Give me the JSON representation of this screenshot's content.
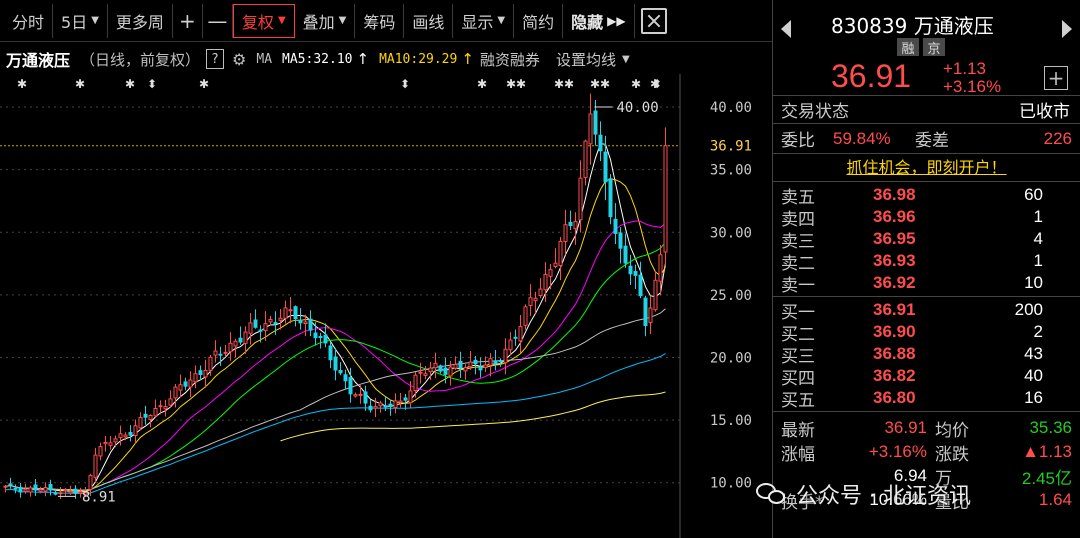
{
  "toolbar": {
    "items": [
      "分时",
      "5日",
      "更多周",
      "+",
      "—",
      "复权",
      "叠加",
      "筹码",
      "画线",
      "显示",
      "简约",
      "隐藏"
    ]
  },
  "chart_header": {
    "name": "万通液压",
    "period": "（日线，前复权）",
    "help": "?",
    "ma_label": "MA",
    "ma5": "MA5:32.10",
    "ma10": "MA10:29.29",
    "rz": "融资融券",
    "setting": "设置均线"
  },
  "chart_data": {
    "type": "candlestick",
    "y_ticks": [
      "40.00",
      "35.00",
      "30.00",
      "25.00",
      "20.00",
      "15.00",
      "10.00"
    ],
    "ylim": [
      7.5,
      42
    ],
    "high_label": "40.00",
    "low_label": "8.91",
    "current_price_label": "36.91",
    "current_price": 36.91
  },
  "quote": {
    "code_name": "830839 万通液压",
    "tags": [
      "融",
      "京"
    ],
    "price": "36.91",
    "change": "+1.13",
    "change_pct": "+3.16%",
    "trade_state_label": "交易状态",
    "trade_state": "已收市",
    "ratio_label": "委比",
    "ratio": "59.84%",
    "diff_label": "委差",
    "diff": "226",
    "ad": "抓住机会，即刻开户！",
    "asks": [
      {
        "label": "卖五",
        "price": "36.98",
        "vol": "60"
      },
      {
        "label": "卖四",
        "price": "36.96",
        "vol": "1"
      },
      {
        "label": "卖三",
        "price": "36.95",
        "vol": "4"
      },
      {
        "label": "卖二",
        "price": "36.93",
        "vol": "1"
      },
      {
        "label": "卖一",
        "price": "36.92",
        "vol": "10"
      }
    ],
    "bids": [
      {
        "label": "买一",
        "price": "36.91",
        "vol": "200"
      },
      {
        "label": "买二",
        "price": "36.90",
        "vol": "2"
      },
      {
        "label": "买三",
        "price": "36.88",
        "vol": "43"
      },
      {
        "label": "买四",
        "price": "36.82",
        "vol": "40"
      },
      {
        "label": "买五",
        "price": "36.80",
        "vol": "16"
      }
    ],
    "stats": [
      {
        "k": "最新",
        "v": "36.91",
        "k2": "均价",
        "v2": "35.36"
      },
      {
        "k": "涨幅",
        "v": "+3.16%",
        "k2": "涨跌",
        "v2": "▲1.13"
      },
      {
        "k": "",
        "v": "6.94",
        "k2": "万",
        "v2": "2.45亿"
      },
      {
        "k": "换手*",
        "v": "10.66%",
        "k2": "量比",
        "v2": "1.64"
      }
    ]
  },
  "watermark": "公众号 · 北证资讯",
  "colors": {
    "up": "#ff4c4c",
    "down": "#22d3e6",
    "ma5": "#ffffff",
    "ma10": "#ffd700",
    "ma20": "#ff00ff",
    "ma30": "#00ff00",
    "ma60": "#bfbfbf",
    "ma120": "#00bfff",
    "ma250": "#ffee55"
  }
}
